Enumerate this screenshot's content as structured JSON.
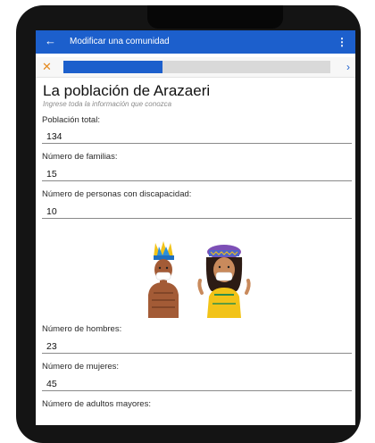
{
  "appbar": {
    "title": "Modificar una comunidad",
    "background_color": "#1c5fcc",
    "back_icon": "arrow-left-icon",
    "menu_icon": "more-vertical-icon"
  },
  "progress": {
    "close_icon": "close-icon",
    "next_icon": "chevron-right-icon",
    "fraction": 0.37,
    "fill_color": "#1c5fcc",
    "close_color": "#e58a1f"
  },
  "form": {
    "heading": "La población de Arazaeri",
    "subtitle": "Ingrese toda la información que conozca",
    "fields": [
      {
        "label": "Población total:",
        "value": "134"
      },
      {
        "label": "Número de familias:",
        "value": "15"
      },
      {
        "label": "Número de personas con discapacidad:",
        "value": "10"
      },
      {
        "label": "Número de hombres:",
        "value": "23"
      },
      {
        "label": "Número de mujeres:",
        "value": "45"
      },
      {
        "label": "Número de adultos mayores:",
        "value": ""
      }
    ]
  }
}
